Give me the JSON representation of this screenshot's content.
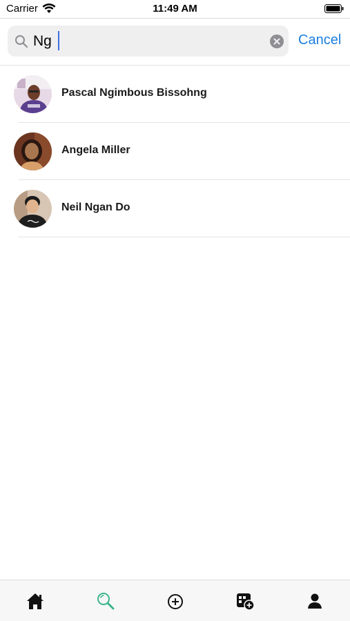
{
  "status_bar": {
    "carrier": "Carrier",
    "time": "11:49 AM"
  },
  "search": {
    "query": "Ng",
    "cancel_label": "Cancel"
  },
  "results": [
    {
      "name": "Pascal Ngimbous Bissohng"
    },
    {
      "name": "Angela Miller"
    },
    {
      "name": "Neil Ngan Do"
    }
  ],
  "tab_bar": {
    "tabs": [
      {
        "icon": "home-icon",
        "active": false
      },
      {
        "icon": "search-icon",
        "active": true
      },
      {
        "icon": "add-icon",
        "active": false
      },
      {
        "icon": "calendar-add-icon",
        "active": false
      },
      {
        "icon": "profile-icon",
        "active": false
      }
    ],
    "active_color": "#3bb58a",
    "inactive_color": "#111111"
  },
  "colors": {
    "accent": "#1a7fe0",
    "caret": "#3b6fe0"
  }
}
